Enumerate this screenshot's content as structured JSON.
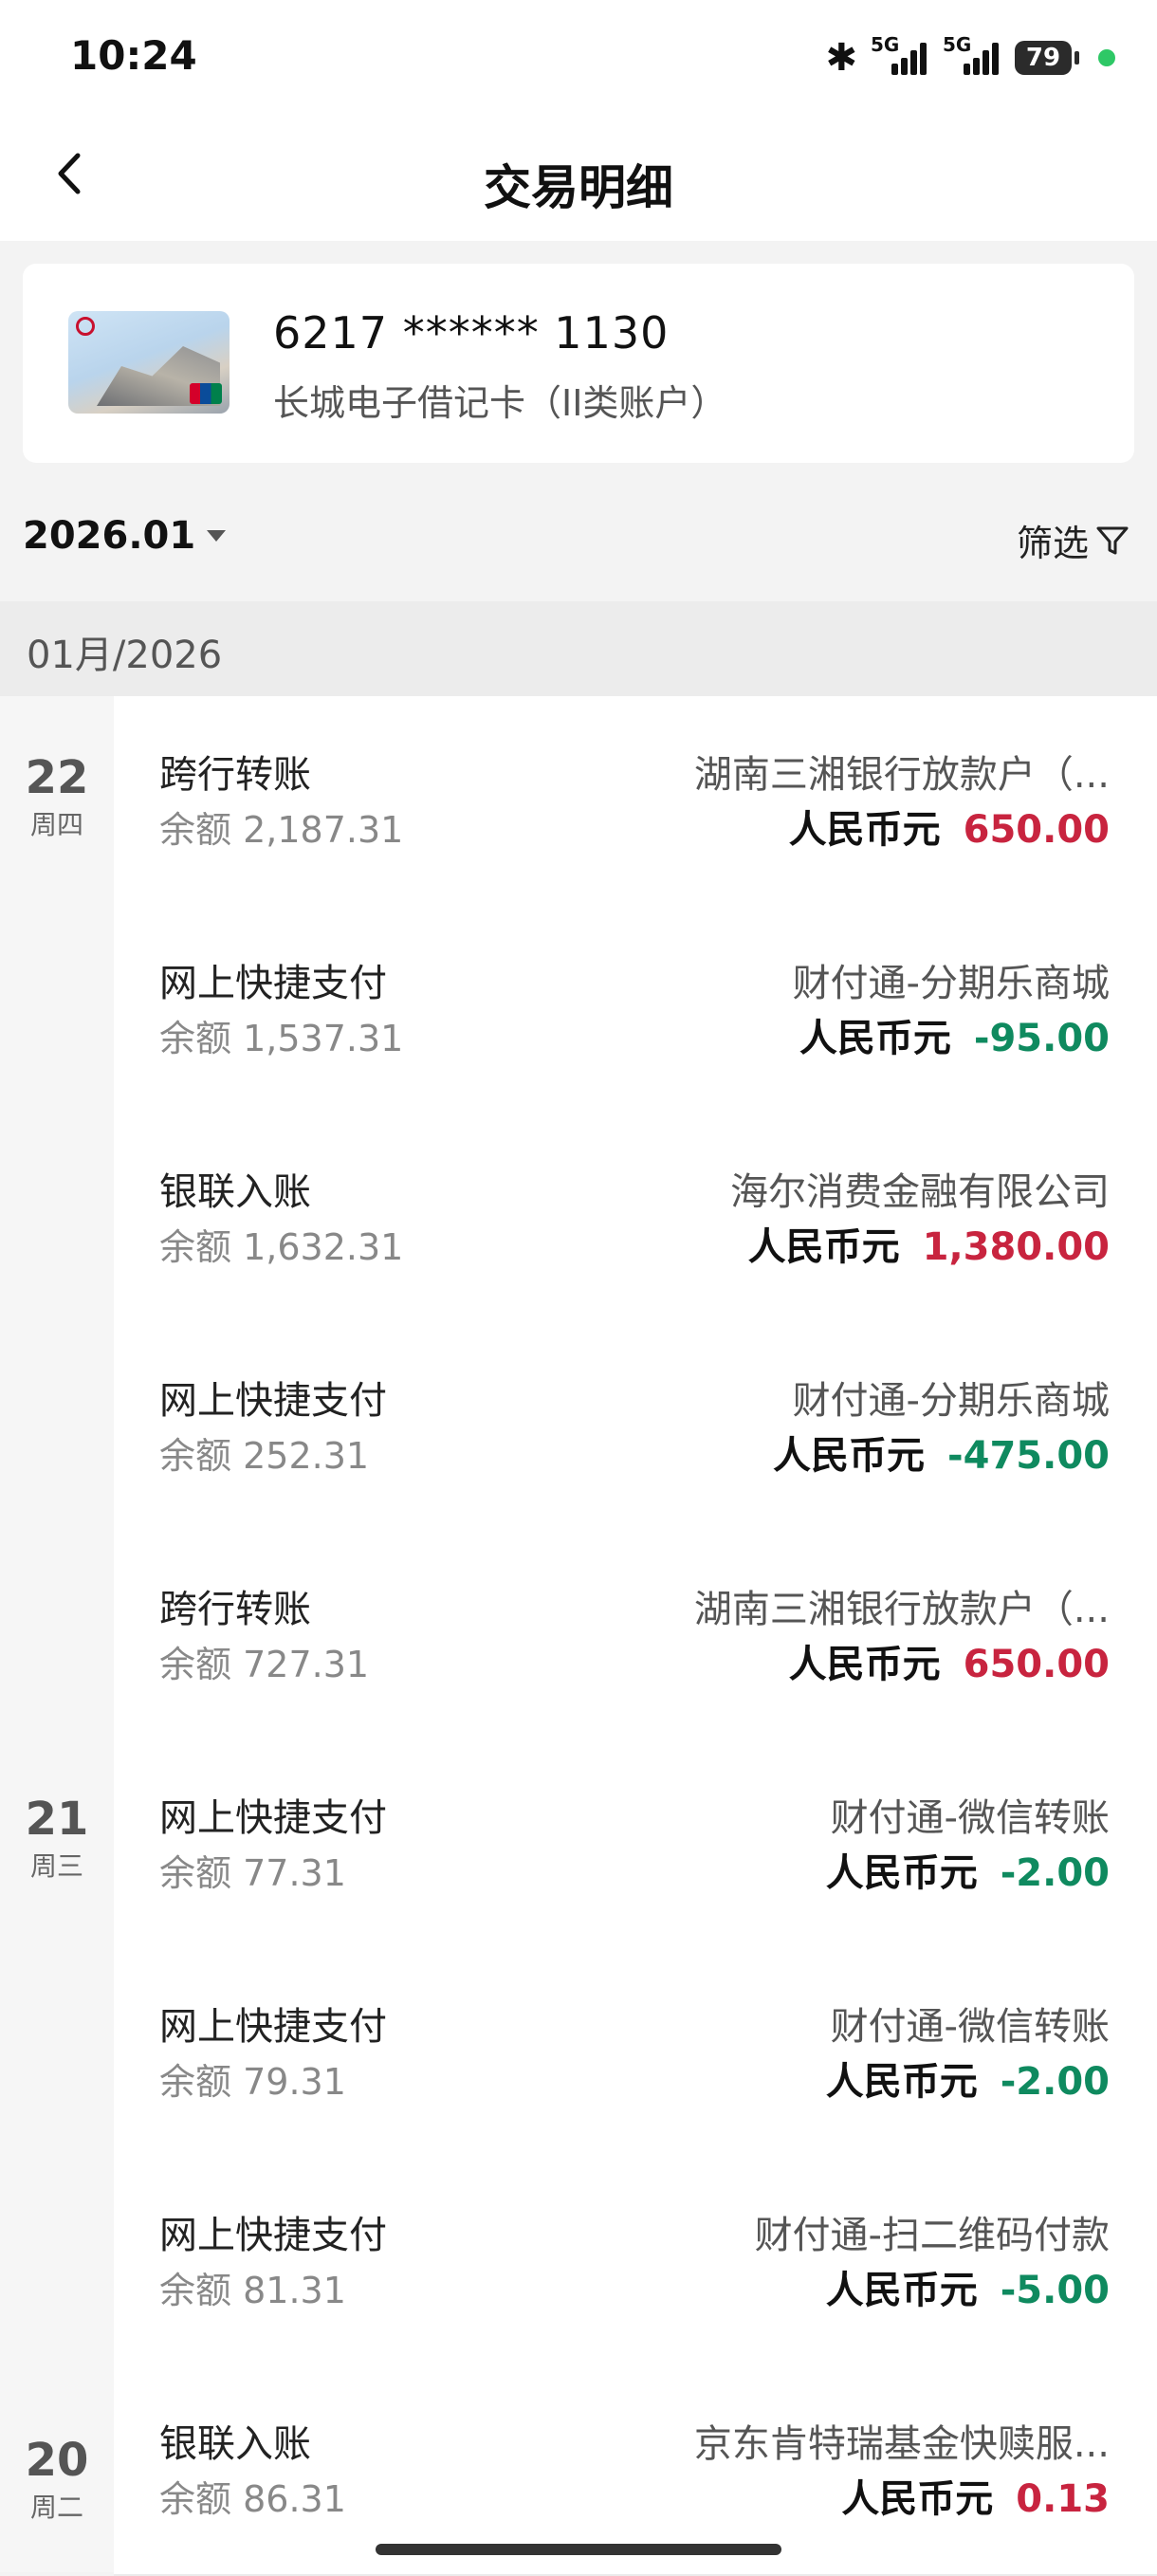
{
  "status_bar": {
    "time": "10:24",
    "battery": "79",
    "network1": "5G",
    "network2": "5G"
  },
  "nav": {
    "title": "交易明细"
  },
  "card": {
    "number": "6217 ****** 1130",
    "type": "长城电子借记卡（II类账户）"
  },
  "filter_bar": {
    "month": "2026.01",
    "filter_label": "筛选"
  },
  "section": {
    "label": "01月/2026"
  },
  "colors": {
    "income": "#c8243f",
    "expense": "#0f8a5f"
  },
  "days": [
    {
      "day": "22",
      "weekday": "周四"
    },
    {
      "day": "21",
      "weekday": "周三"
    },
    {
      "day": "20",
      "weekday": "周二"
    }
  ],
  "transactions": [
    {
      "type": "跨行转账",
      "balance_label": "余额",
      "balance": "2,187.31",
      "counterparty": "湖南三湘银行放款户（...",
      "currency": "人民币元",
      "amount": "650.00",
      "direction": "in"
    },
    {
      "type": "网上快捷支付",
      "balance_label": "余额",
      "balance": "1,537.31",
      "counterparty": "财付通-分期乐商城",
      "currency": "人民币元",
      "amount": "-95.00",
      "direction": "out"
    },
    {
      "type": "银联入账",
      "balance_label": "余额",
      "balance": "1,632.31",
      "counterparty": "海尔消费金融有限公司",
      "currency": "人民币元",
      "amount": "1,380.00",
      "direction": "in"
    },
    {
      "type": "网上快捷支付",
      "balance_label": "余额",
      "balance": "252.31",
      "counterparty": "财付通-分期乐商城",
      "currency": "人民币元",
      "amount": "-475.00",
      "direction": "out"
    },
    {
      "type": "跨行转账",
      "balance_label": "余额",
      "balance": "727.31",
      "counterparty": "湖南三湘银行放款户（...",
      "currency": "人民币元",
      "amount": "650.00",
      "direction": "in"
    },
    {
      "type": "网上快捷支付",
      "balance_label": "余额",
      "balance": "77.31",
      "counterparty": "财付通-微信转账",
      "currency": "人民币元",
      "amount": "-2.00",
      "direction": "out"
    },
    {
      "type": "网上快捷支付",
      "balance_label": "余额",
      "balance": "79.31",
      "counterparty": "财付通-微信转账",
      "currency": "人民币元",
      "amount": "-2.00",
      "direction": "out"
    },
    {
      "type": "网上快捷支付",
      "balance_label": "余额",
      "balance": "81.31",
      "counterparty": "财付通-扫二维码付款",
      "currency": "人民币元",
      "amount": "-5.00",
      "direction": "out"
    },
    {
      "type": "银联入账",
      "balance_label": "余额",
      "balance": "86.31",
      "counterparty": "京东肯特瑞基金快赎服...",
      "currency": "人民币元",
      "amount": "0.13",
      "direction": "in"
    }
  ]
}
